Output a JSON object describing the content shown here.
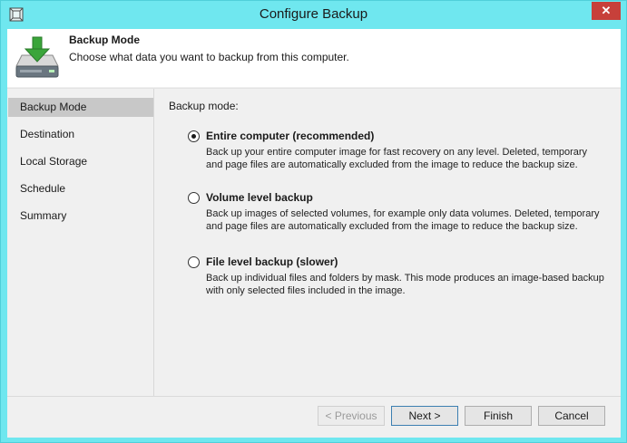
{
  "window": {
    "title": "Configure Backup",
    "close_label": "✕"
  },
  "header": {
    "title": "Backup Mode",
    "description": "Choose what data you want to backup from this computer."
  },
  "sidebar": {
    "items": [
      {
        "label": "Backup Mode",
        "active": true
      },
      {
        "label": "Destination"
      },
      {
        "label": "Local Storage"
      },
      {
        "label": "Schedule"
      },
      {
        "label": "Summary"
      }
    ]
  },
  "main": {
    "mode_label": "Backup mode:",
    "options": [
      {
        "title": "Entire computer (recommended)",
        "description": "Back up your entire computer image for fast recovery on any level. Deleted, temporary and page files are automatically excluded from the image to reduce the backup size.",
        "selected": true
      },
      {
        "title": "Volume level backup",
        "description": "Back up images of selected volumes, for example only data volumes. Deleted, temporary and page files are automatically excluded from the image to reduce the backup size.",
        "selected": false
      },
      {
        "title": "File level backup (slower)",
        "description": "Back up individual files and folders by mask. This mode produces an image-based backup with only selected files included in the image.",
        "selected": false
      }
    ]
  },
  "footer": {
    "previous_label": "< Previous",
    "next_label": "Next >",
    "finish_label": "Finish",
    "cancel_label": "Cancel"
  },
  "icons": {
    "app": "app-icon",
    "header": "backup-drive-icon"
  },
  "colors": {
    "titlebar": "#6fe7ef",
    "close_button": "#c7403a",
    "selected_nav": "#c8c8c8",
    "arrow": "#3aa53a"
  }
}
